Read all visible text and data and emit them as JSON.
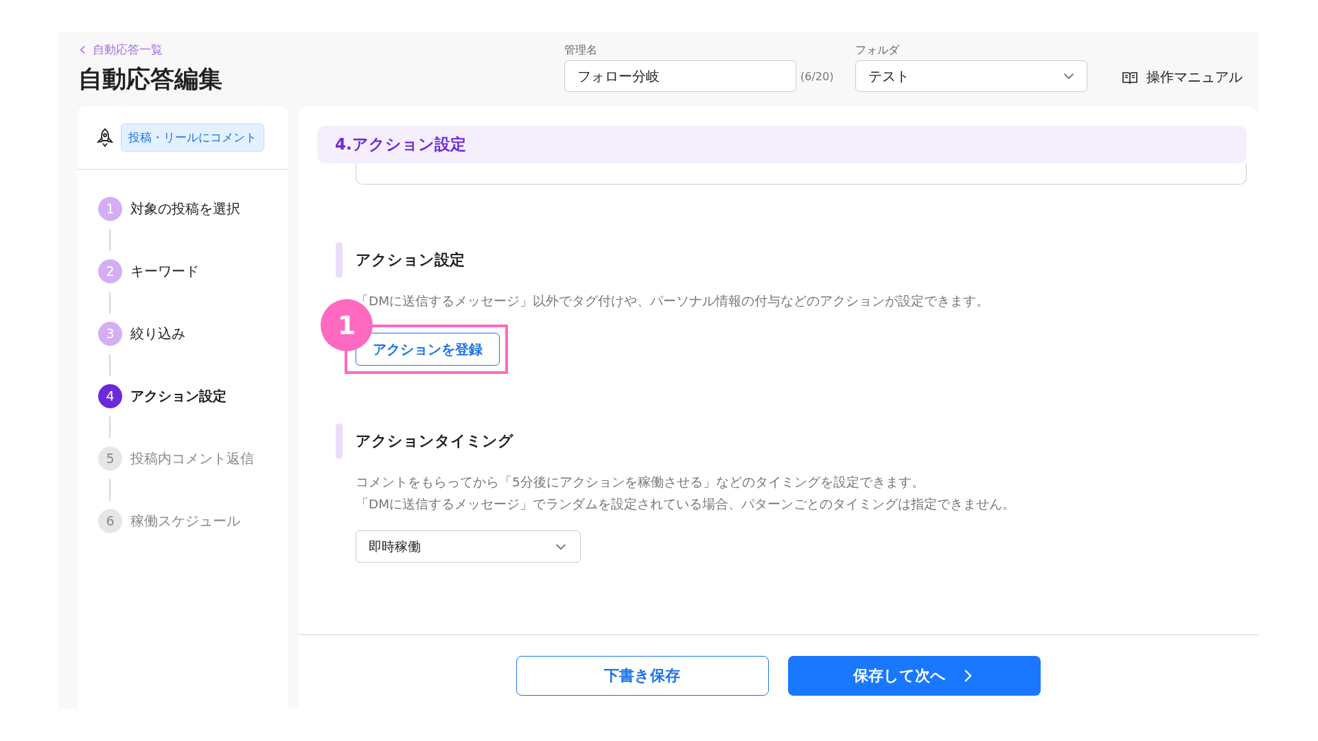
{
  "header": {
    "back_link": "自動応答一覧",
    "title": "自動応答編集",
    "name_field": {
      "label": "管理名",
      "value": "フォロー分岐",
      "counter": "(6/20)"
    },
    "folder_field": {
      "label": "フォルダ",
      "value": "テスト"
    },
    "manual_link": "操作マニュアル"
  },
  "sidebar": {
    "trigger_tag": "投稿・リールにコメント",
    "steps": [
      {
        "number": "1",
        "label": "対象の投稿を選択",
        "kind": "done"
      },
      {
        "number": "2",
        "label": "キーワード",
        "kind": "done"
      },
      {
        "number": "3",
        "label": "絞り込み",
        "kind": "done"
      },
      {
        "number": "4",
        "label": "アクション設定",
        "kind": "current"
      },
      {
        "number": "5",
        "label": "投稿内コメント返信",
        "kind": "pending"
      },
      {
        "number": "6",
        "label": "稼働スケジュール",
        "kind": "pending"
      }
    ]
  },
  "main": {
    "section_header": "4.アクション設定",
    "sections": [
      {
        "kind": "button",
        "title": "アクション設定",
        "description": [
          "「DMに送信するメッセージ」以外でタグ付けや、パーソナル情報の付与などのアクションが設定できます。"
        ],
        "button": "アクションを登録",
        "annotation": "1"
      },
      {
        "kind": "select",
        "title": "アクションタイミング",
        "description": [
          "コメントをもらってから「5分後にアクションを稼働させる」などのタイミングを設定できます。",
          "「DMに送信するメッセージ」でランダムを設定されている場合、パターンごとのタイミングは指定できません。"
        ],
        "select_value": "即時稼働"
      }
    ]
  },
  "footer": {
    "buttons": [
      {
        "label": "下書き保存",
        "kind": "secondary"
      },
      {
        "label": "保存して次へ",
        "kind": "primary"
      }
    ]
  }
}
